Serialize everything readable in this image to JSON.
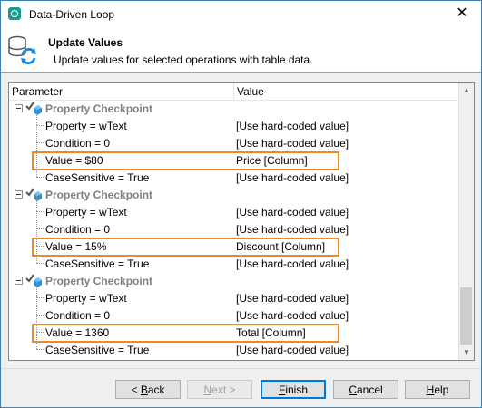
{
  "window": {
    "title": "Data-Driven Loop",
    "close_glyph": "✕"
  },
  "header": {
    "title": "Update Values",
    "subtitle": "Update values for selected operations with table data.",
    "icon": "database-sync-icon"
  },
  "table": {
    "col_param": "Parameter",
    "col_value": "Value",
    "groups": [
      {
        "label": "Property Checkpoint",
        "rows": [
          {
            "param": "Property = wText",
            "value": "[Use hard-coded value]",
            "highlight": false
          },
          {
            "param": "Condition = 0",
            "value": "[Use hard-coded value]",
            "highlight": false
          },
          {
            "param": "Value = $80",
            "value": "Price [Column]",
            "highlight": true
          },
          {
            "param": "CaseSensitive = True",
            "value": "[Use hard-coded value]",
            "highlight": false
          }
        ]
      },
      {
        "label": "Property Checkpoint",
        "rows": [
          {
            "param": "Property = wText",
            "value": "[Use hard-coded value]",
            "highlight": false
          },
          {
            "param": "Condition = 0",
            "value": "[Use hard-coded value]",
            "highlight": false
          },
          {
            "param": "Value = 15%",
            "value": "Discount [Column]",
            "highlight": true
          },
          {
            "param": "CaseSensitive = True",
            "value": "[Use hard-coded value]",
            "highlight": false
          }
        ]
      },
      {
        "label": "Property Checkpoint",
        "rows": [
          {
            "param": "Property = wText",
            "value": "[Use hard-coded value]",
            "highlight": false
          },
          {
            "param": "Condition = 0",
            "value": "[Use hard-coded value]",
            "highlight": false
          },
          {
            "param": "Value = 1360",
            "value": "Total [Column]",
            "highlight": true
          },
          {
            "param": "CaseSensitive = True",
            "value": "[Use hard-coded value]",
            "highlight": false
          }
        ]
      }
    ]
  },
  "buttons": {
    "back": "< Back",
    "next": "Next >",
    "finish": "Finish",
    "cancel": "Cancel",
    "help": "Help"
  },
  "colors": {
    "highlight": "#f08a1e",
    "group_text": "#808080",
    "accent": "#0078d7"
  }
}
